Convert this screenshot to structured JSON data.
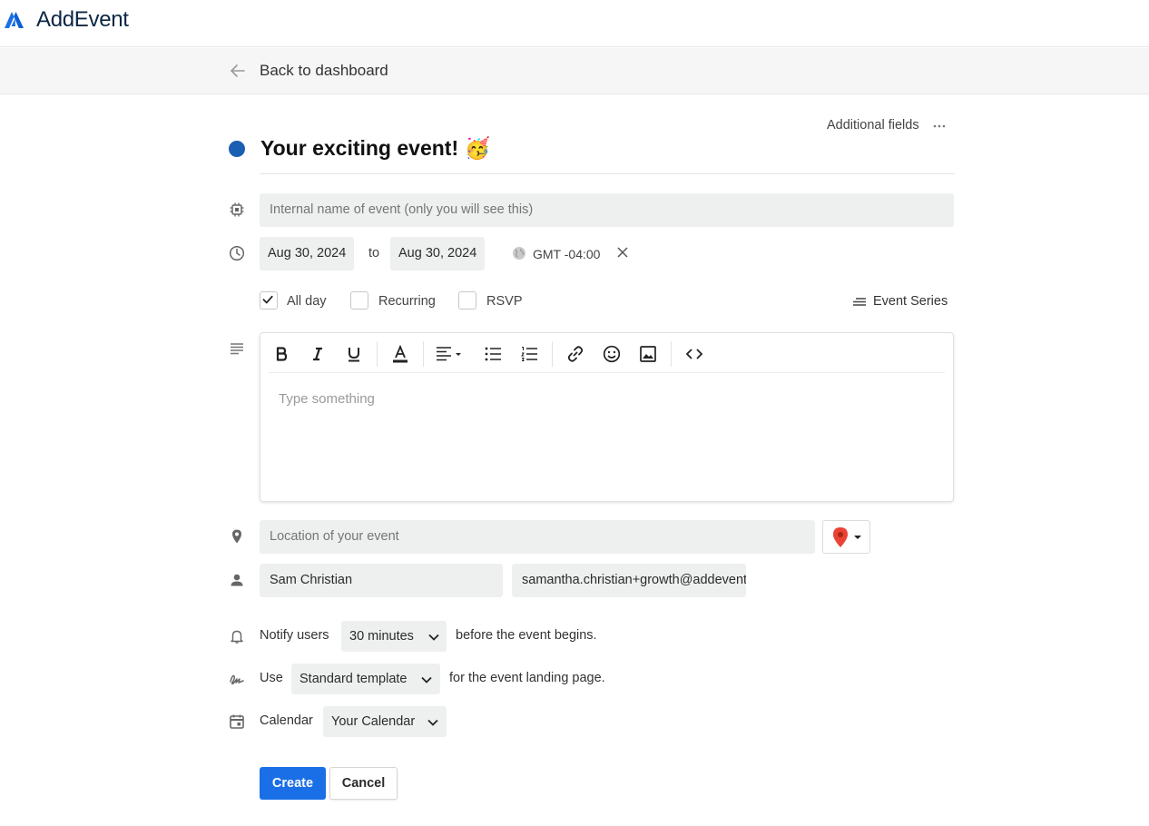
{
  "app": {
    "name": "AddEvent"
  },
  "nav": {
    "back_label": "Back to dashboard"
  },
  "header": {
    "additional_fields_label": "Additional fields"
  },
  "event": {
    "title": "Your exciting event! 🥳",
    "color": "#1b5fb3",
    "internal_name_placeholder": "Internal name of event (only you will see this)",
    "start_date": "Aug 30, 2024",
    "to_label": "to",
    "end_date": "Aug 30, 2024",
    "timezone": "GMT -04:00"
  },
  "options": {
    "all_day": {
      "label": "All day",
      "checked": true
    },
    "recurring": {
      "label": "Recurring",
      "checked": false
    },
    "rsvp": {
      "label": "RSVP",
      "checked": false
    },
    "event_series_label": "Event Series"
  },
  "editor": {
    "toolbar": [
      "bold",
      "italic",
      "underline",
      "text-color",
      "align",
      "bullet-list",
      "numbered-list",
      "link",
      "emoji",
      "image",
      "code"
    ],
    "placeholder": "Type something"
  },
  "location": {
    "placeholder": "Location of your event",
    "map_provider_icon": "map-pin-icon"
  },
  "organizer": {
    "name": "Sam Christian",
    "email": "samantha.christian+growth@addevent.com"
  },
  "notify": {
    "prefix": "Notify users",
    "value": "30 minutes",
    "suffix": "before the event begins."
  },
  "template": {
    "prefix": "Use",
    "value": "Standard template",
    "suffix": "for the event landing page."
  },
  "calendar": {
    "prefix": "Calendar",
    "value": "Your Calendar"
  },
  "actions": {
    "create_label": "Create",
    "cancel_label": "Cancel"
  },
  "colors": {
    "accent": "#1a6fe6",
    "brand_dark": "#0c2744",
    "event_dot": "#1b5fb3"
  }
}
